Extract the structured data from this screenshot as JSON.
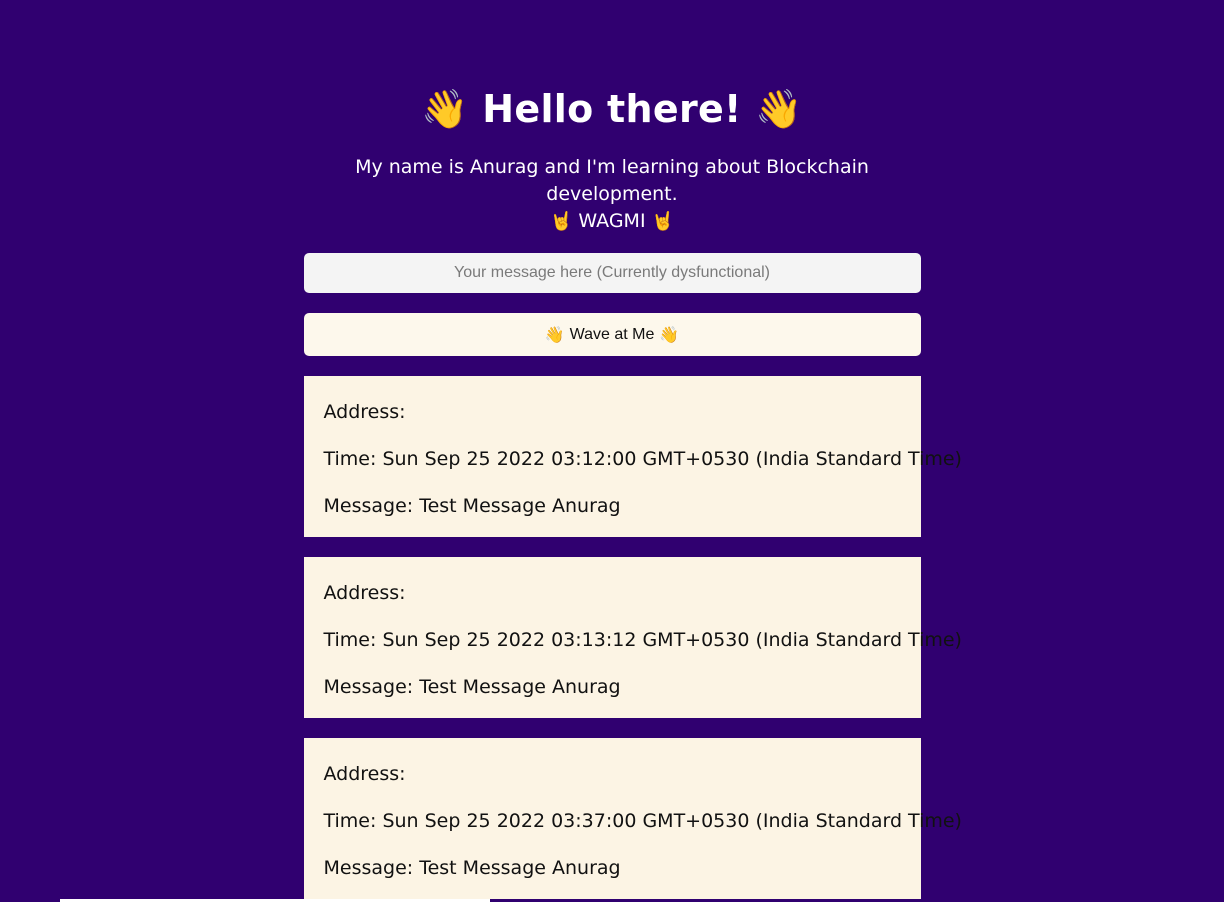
{
  "header": {
    "title": "Hello there!",
    "left_emoji": "👋",
    "right_emoji": "👋"
  },
  "bio": {
    "line1": "My name is Anurag and I'm learning about Blockchain development.",
    "line2_emoji_left": "🤘",
    "line2_text": "WAGMI",
    "line2_emoji_right": "🤘"
  },
  "message_input": {
    "value": "",
    "placeholder": "Your message here (Currently dysfunctional)"
  },
  "wave_button": {
    "emoji_left": "👋",
    "label": "Wave at Me",
    "emoji_right": "👋"
  },
  "waves": [
    {
      "address": "Address:",
      "time": "Time: Sun Sep 25 2022 03:12:00 GMT+0530 (India Standard Time)",
      "message": "Message: Test Message Anurag"
    },
    {
      "address": "Address:",
      "time": "Time: Sun Sep 25 2022 03:13:12 GMT+0530 (India Standard Time)",
      "message": "Message: Test Message Anurag"
    },
    {
      "address": "Address:",
      "time": "Time: Sun Sep 25 2022 03:37:00 GMT+0530 (India Standard Time)",
      "message": "Message: Test Message Anurag"
    }
  ],
  "colors": {
    "background": "#300070",
    "card": "#fcf4e4",
    "button": "#fdf8ec",
    "input": "#f4f4f4"
  }
}
